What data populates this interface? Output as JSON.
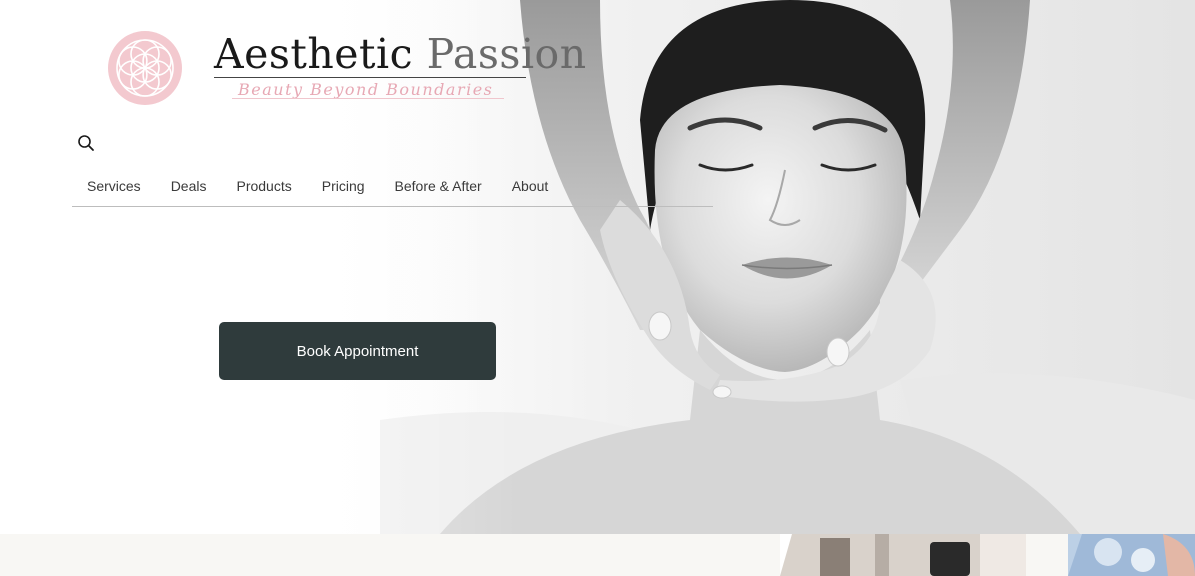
{
  "brand": {
    "name_first": "Aesthetic",
    "name_second": "Passion",
    "tagline": "Beauty Beyond Boundaries",
    "logo_icon": "flower-of-life-icon",
    "logo_color": "#f3c9cf",
    "tagline_color": "#e7a8b4"
  },
  "search": {
    "icon": "search-icon"
  },
  "nav": {
    "items": [
      {
        "label": "Services"
      },
      {
        "label": "Deals"
      },
      {
        "label": "Products"
      },
      {
        "label": "Pricing"
      },
      {
        "label": "Before & After"
      },
      {
        "label": "About"
      }
    ]
  },
  "hero": {
    "cta_label": "Book Appointment",
    "cta_color": "#2f3b3c",
    "image": "woman-receiving-facial-massage"
  },
  "next_section": {
    "background_color": "#f8f7f4"
  }
}
